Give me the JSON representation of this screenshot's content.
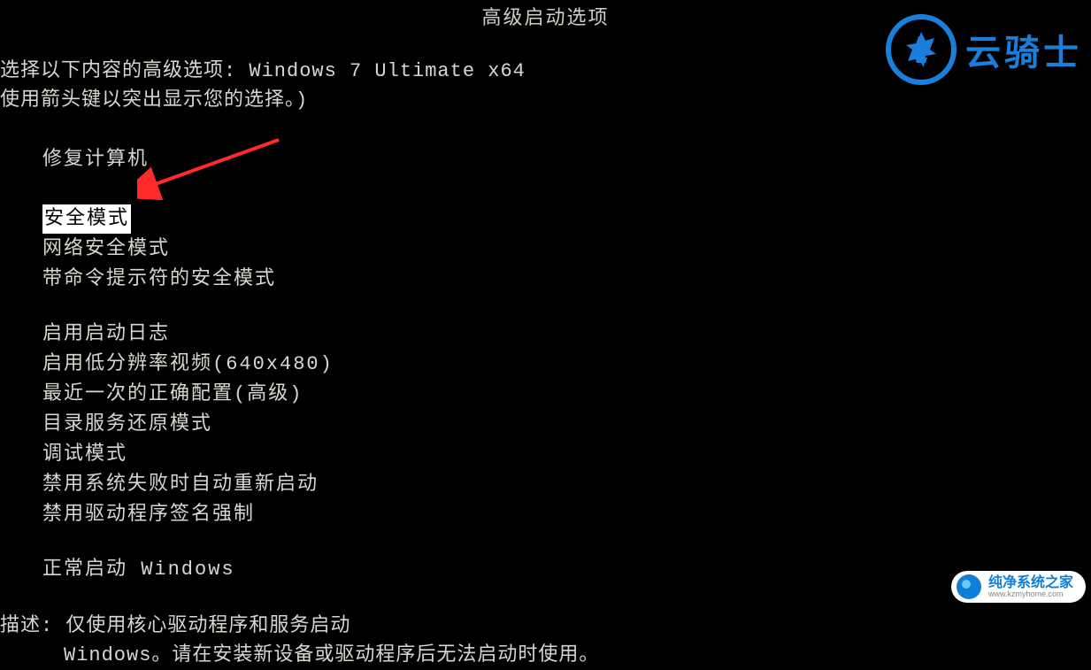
{
  "title": "高级启动选项",
  "prompt": {
    "line1": "选择以下内容的高级选项: Windows 7 Ultimate x64",
    "line2": "使用箭头键以突出显示您的选择。)"
  },
  "repair_option": "修复计算机",
  "menu": {
    "safe_mode": "安全模式",
    "safe_mode_network": "网络安全模式",
    "safe_mode_cmd": "带命令提示符的安全模式",
    "boot_log": "启用启动日志",
    "low_res": "启用低分辨率视频(640x480)",
    "last_known": "最近一次的正确配置(高级)",
    "ds_restore": "目录服务还原模式",
    "debug": "调试模式",
    "disable_auto_restart": "禁用系统失败时自动重新启动",
    "disable_driver_sig": "禁用驱动程序签名强制",
    "normal": "正常启动 Windows"
  },
  "description": {
    "label": "描述:",
    "line1": "仅使用核心驱动程序和服务启动",
    "line2": "Windows。请在安装新设备或驱动程序后无法启动时使用。"
  },
  "watermark_top": {
    "text": "云骑士"
  },
  "watermark_bottom": {
    "name": "纯净系统之家",
    "url": "www.kzmyhome.com"
  }
}
